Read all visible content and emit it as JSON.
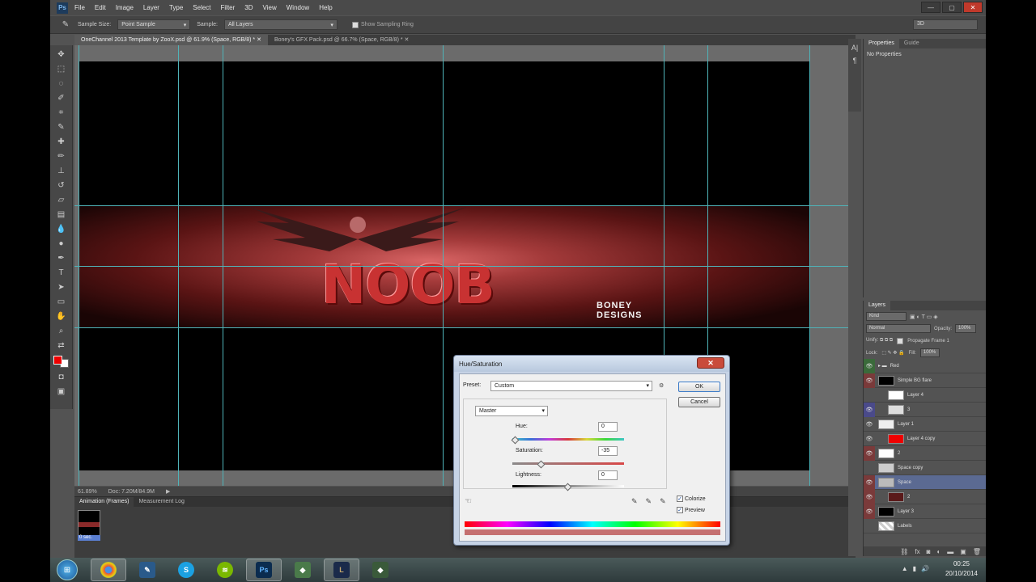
{
  "menu": [
    "File",
    "Edit",
    "Image",
    "Layer",
    "Type",
    "Select",
    "Filter",
    "3D",
    "View",
    "Window",
    "Help"
  ],
  "options": {
    "sample_size_label": "Sample Size:",
    "sample_size_value": "Point Sample",
    "sample_label": "Sample:",
    "sample_value": "All Layers",
    "show_ring_label": "Show Sampling Ring",
    "workspace": "3D"
  },
  "tabs": [
    "OneChannel 2013 Template by ZooX.psd @ 61.9% (Space, RGB/8) *",
    "Boney's GFX Pack.psd @ 66.7% (Space, RGB/8) *"
  ],
  "canvas_text": {
    "main": "NOOB",
    "logo_line1": "BONEY",
    "logo_line2": "DESIGNS"
  },
  "status": {
    "zoom": "61.89%",
    "doc": "Doc: 7.20M/84.9M"
  },
  "animation": {
    "tabs": [
      "Animation (Frames)",
      "Measurement Log"
    ],
    "frame_number": "1",
    "frame_time": "0 sec."
  },
  "properties": {
    "tabs": [
      "Properties",
      "Guide"
    ],
    "empty": "No Properties"
  },
  "layers_panel": {
    "title": "Layers",
    "kind": "Kind",
    "blend": "Normal",
    "opacity_label": "Opacity:",
    "opacity_value": "100%",
    "lock_label": "Lock:",
    "propagate_label": "Propagate Frame 1",
    "fill_label": "Fill:",
    "fill_value": "100%",
    "layers": [
      {
        "name": "Red",
        "eye": "green"
      },
      {
        "name": "Simple BG flare",
        "eye": "red"
      },
      {
        "name": "Layer 4",
        "eye": ""
      },
      {
        "name": "3",
        "eye": "blue"
      },
      {
        "name": "Layer 1",
        "eye": "red"
      },
      {
        "name": "Layer 4 copy",
        "eye": ""
      },
      {
        "name": "2",
        "eye": "red"
      },
      {
        "name": "Space copy",
        "eye": ""
      },
      {
        "name": "Space",
        "eye": "red",
        "selected": true
      },
      {
        "name": "2",
        "eye": "red"
      },
      {
        "name": "Layer 3",
        "eye": "red"
      },
      {
        "name": "Labels",
        "eye": ""
      }
    ]
  },
  "dialog": {
    "title": "Hue/Saturation",
    "close": "✕",
    "preset_label": "Preset:",
    "preset_value": "Custom",
    "edit_value": "Master",
    "ok": "OK",
    "cancel": "Cancel",
    "hue_label": "Hue:",
    "hue_value": "0",
    "saturation_label": "Saturation:",
    "saturation_value": "-35",
    "lightness_label": "Lightness:",
    "lightness_value": "0",
    "colorize_label": "Colorize",
    "preview_label": "Preview",
    "colorize_checked": true,
    "preview_checked": true
  },
  "taskbar": {
    "time": "00:25",
    "date": "20/10/2014"
  }
}
